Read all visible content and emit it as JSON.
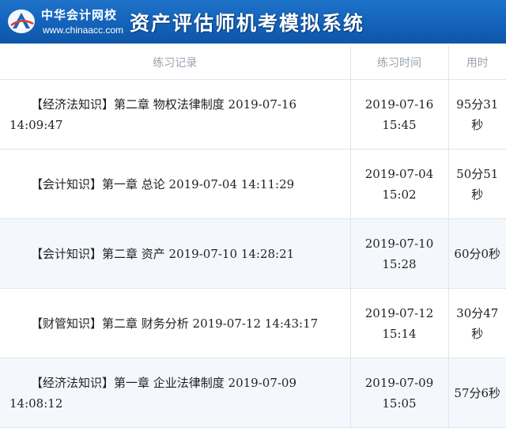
{
  "header": {
    "brand": "中华会计网校",
    "domain": "www.chinaacc.com",
    "system_title": "资产评估师机考模拟系统"
  },
  "table": {
    "columns": [
      "练习记录",
      "练习时间",
      "用时"
    ],
    "rows": [
      {
        "record": "【经济法知识】第二章 物权法律制度 2019-07-16 14:09:47",
        "time": "2019-07-16 15:45",
        "duration": "95分31秒"
      },
      {
        "record": "【会计知识】第一章 总论 2019-07-04 14:11:29",
        "time": "2019-07-04 15:02",
        "duration": "50分51秒"
      },
      {
        "record": "【会计知识】第二章 资产 2019-07-10 14:28:21",
        "time": "2019-07-10 15:28",
        "duration": "60分0秒"
      },
      {
        "record": "【财管知识】第二章 财务分析 2019-07-12 14:43:17",
        "time": "2019-07-12 15:14",
        "duration": "30分47秒"
      },
      {
        "record": "【经济法知识】第一章 企业法律制度 2019-07-09 14:08:12",
        "time": "2019-07-09 15:05",
        "duration": "57分6秒"
      }
    ]
  }
}
